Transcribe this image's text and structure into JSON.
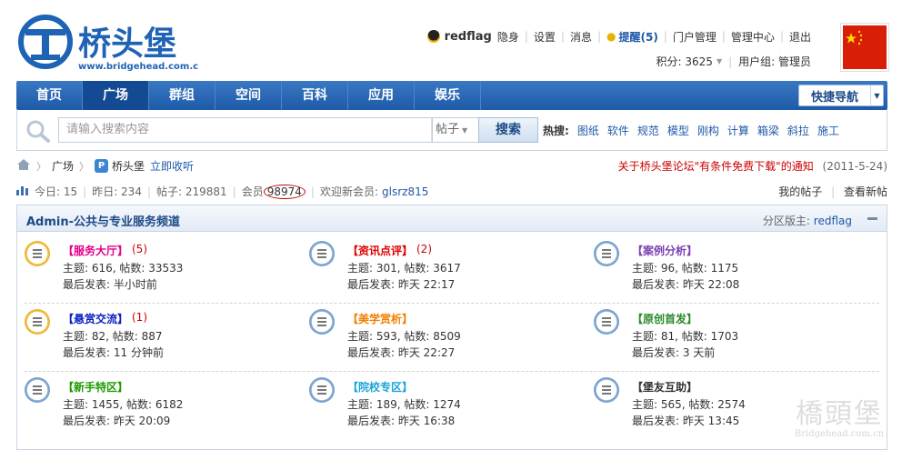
{
  "site": {
    "logo_text": "桥头堡",
    "logo_url": "www.bridgehead.com.cn"
  },
  "userbar": {
    "username": "redflag",
    "items": [
      "隐身",
      "设置",
      "消息"
    ],
    "remind": "提醒(5)",
    "links": [
      "门户管理",
      "管理中心",
      "退出"
    ]
  },
  "infobar": {
    "credits": "积分: 3625",
    "usergroup": "用户组: 管理员"
  },
  "nav": {
    "items": [
      "首页",
      "广场",
      "群组",
      "空间",
      "百科",
      "应用",
      "娱乐"
    ],
    "active_index": 1,
    "quicknav": "快捷导航"
  },
  "search": {
    "placeholder": "请输入搜索内容",
    "type": "帖子",
    "button": "搜索",
    "hot_label": "热搜:",
    "hot": [
      "图纸",
      "软件",
      "规范",
      "模型",
      "刚构",
      "计算",
      "箱梁",
      "斜拉",
      "施工"
    ]
  },
  "breadcrumb": {
    "items": [
      "广场",
      "桥头堡"
    ],
    "fav": "立即收听"
  },
  "notice": {
    "text": "关于桥头堡论坛\"有条件免费下载\"的通知",
    "date": "(2011-5-24)"
  },
  "stats": {
    "today": "今日: 15",
    "yesterday": "昨日: 234",
    "posts": "帖子: 219881",
    "members_label": "会员",
    "members": "98974",
    "welcome": "欢迎新会员:",
    "newest": "glsrz815"
  },
  "mylinks": [
    "我的帖子",
    "查看新帖"
  ],
  "board": {
    "title": "Admin-公共与专业服务频道",
    "moderator_label": "分区版主:",
    "moderator": "redflag",
    "forums": [
      {
        "name": "【服务大厅】",
        "count": "(5)",
        "color": "#e4008c",
        "stat": "主题: 616, 帖数: 33533",
        "last": "最后发表: 半小时前",
        "new": true
      },
      {
        "name": "【资讯点评】",
        "count": "(2)",
        "color": "#e00000",
        "stat": "主题: 301, 帖数: 3617",
        "last": "最后发表: 昨天 22:17",
        "new": false
      },
      {
        "name": "【案例分析】",
        "count": "",
        "color": "#7b3fb2",
        "stat": "主题: 96, 帖数: 1175",
        "last": "最后发表: 昨天 22:08",
        "new": false
      },
      {
        "name": "【悬赏交流】",
        "count": "(1)",
        "color": "#0a1ec2",
        "stat": "主题: 82, 帖数: 887",
        "last": "最后发表: 11 分钟前",
        "new": true
      },
      {
        "name": "【美学赏析】",
        "count": "",
        "color": "#f08000",
        "stat": "主题: 593, 帖数: 8509",
        "last": "最后发表: 昨天 22:27",
        "new": false
      },
      {
        "name": "【原创首发】",
        "count": "",
        "color": "#2a8a2a",
        "stat": "主题: 81, 帖数: 1703",
        "last": "最后发表: 3 天前",
        "new": false
      },
      {
        "name": "【新手特区】",
        "count": "",
        "color": "#1f9a00",
        "stat": "主题: 1455, 帖数: 6182",
        "last": "最后发表: 昨天 20:09",
        "new": false
      },
      {
        "name": "【院校专区】",
        "count": "",
        "color": "#1ca3d8",
        "stat": "主题: 189, 帖数: 1274",
        "last": "最后发表: 昨天 16:38",
        "new": false
      },
      {
        "name": "【堡友互助】",
        "count": "",
        "color": "#333333",
        "stat": "主题: 565, 帖数: 2574",
        "last": "最后发表: 昨天 13:45",
        "new": false
      }
    ]
  },
  "watermark": {
    "text": "橋頭堡",
    "url": "Bridgehead.com.cn"
  }
}
